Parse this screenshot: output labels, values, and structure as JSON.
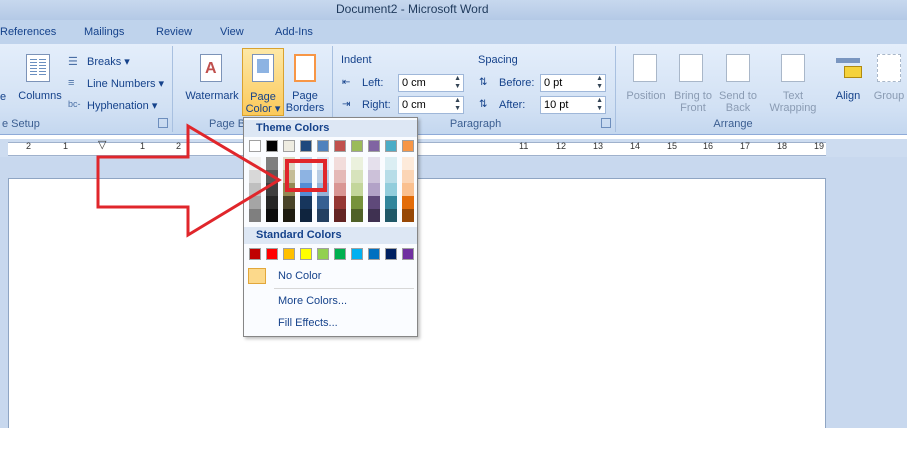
{
  "window": {
    "title": "Document2 - Microsoft Word"
  },
  "tabs": [
    "References",
    "Mailings",
    "Review",
    "View",
    "Add-Ins"
  ],
  "page_setup": {
    "columns": "Columns",
    "breaks": "Breaks",
    "line_numbers": "Line Numbers",
    "hyphenation": "Hyphenation",
    "group_label": "e Setup",
    "e_left": "e"
  },
  "page_background": {
    "watermark": "Watermark",
    "page_color_1": "Page",
    "page_color_2": "Color",
    "page_borders_1": "Page",
    "page_borders_2": "Borders",
    "group_label": "Page B"
  },
  "paragraph": {
    "indent_title": "Indent",
    "left_label": "Left:",
    "left_value": "0 cm",
    "right_label": "Right:",
    "right_value": "0 cm",
    "spacing_title": "Spacing",
    "before_label": "Before:",
    "before_value": "0 pt",
    "after_label": "After:",
    "after_value": "10 pt",
    "group_label": "Paragraph"
  },
  "arrange": {
    "position": "Position",
    "bring_1": "Bring to",
    "bring_2": "Front",
    "send_1": "Send to",
    "send_2": "Back",
    "wrap_1": "Text",
    "wrap_2": "Wrapping",
    "align": "Align",
    "group": "Group",
    "group_label": "Arrange"
  },
  "ruler_ticks": [
    "2",
    "1",
    "1",
    "2",
    "11",
    "12",
    "13",
    "14",
    "15",
    "16",
    "17",
    "18",
    "19"
  ],
  "page_color_menu": {
    "theme_colors_header": "Theme Colors",
    "standard_colors_header": "Standard Colors",
    "no_color": "No Color",
    "more_colors": "More Colors...",
    "fill_effects": "Fill Effects...",
    "theme_top": [
      "#ffffff",
      "#000000",
      "#eeece1",
      "#1f497d",
      "#4f81bd",
      "#c0504d",
      "#9bbb59",
      "#8064a2",
      "#4bacc6",
      "#f79646"
    ],
    "theme_shades": [
      [
        "#f2f2f2",
        "#d8d8d8",
        "#bfbfbf",
        "#a5a5a5",
        "#7f7f7f"
      ],
      [
        "#7f7f7f",
        "#595959",
        "#3f3f3f",
        "#262626",
        "#0c0c0c"
      ],
      [
        "#ddd9c3",
        "#c4bd97",
        "#938953",
        "#494429",
        "#1d1b10"
      ],
      [
        "#c6d9f0",
        "#8db3e2",
        "#548dd4",
        "#17365d",
        "#0f243e"
      ],
      [
        "#dbe5f1",
        "#b8cce4",
        "#95b3d7",
        "#366092",
        "#244061"
      ],
      [
        "#f2dcdb",
        "#e5b9b7",
        "#d99694",
        "#953734",
        "#632423"
      ],
      [
        "#ebf1dd",
        "#d7e3bc",
        "#c3d69b",
        "#76923c",
        "#4f6128"
      ],
      [
        "#e5e0ec",
        "#ccc1d9",
        "#b2a2c7",
        "#5f497a",
        "#3f3151"
      ],
      [
        "#dbeef3",
        "#b7dde8",
        "#92cddc",
        "#31859b",
        "#205867"
      ],
      [
        "#fdeada",
        "#fbd5b5",
        "#fac08f",
        "#e36c09",
        "#974806"
      ]
    ],
    "standard": [
      "#c00000",
      "#ff0000",
      "#ffc000",
      "#ffff00",
      "#92d050",
      "#00b050",
      "#00b0f0",
      "#0070c0",
      "#002060",
      "#7030a0"
    ]
  },
  "annotation_color": "#e0262b"
}
